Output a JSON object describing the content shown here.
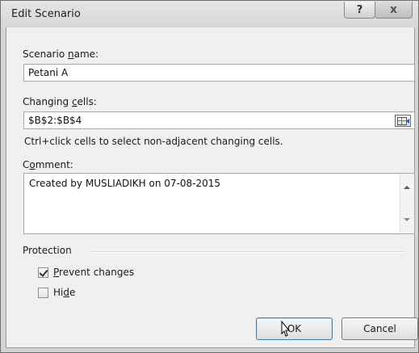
{
  "window": {
    "title": "Edit Scenario",
    "help_glyph": "?",
    "close_glyph": "x"
  },
  "scenario_name": {
    "label_pre": "Scenario ",
    "label_hot": "n",
    "label_post": "ame:",
    "value": "Petani A"
  },
  "changing_cells": {
    "label_pre": "Changing ",
    "label_hot": "c",
    "label_post": "ells:",
    "value": "$B$2:$B$4",
    "hint": "Ctrl+click cells to select non-adjacent changing cells."
  },
  "comment": {
    "label_pre": "C",
    "label_hot": "o",
    "label_post": "mment:",
    "value": "Created by MUSLIADIKH on 07-08-2015"
  },
  "protection": {
    "group_label": "Protection",
    "prevent_changes": {
      "hot": "P",
      "rest": "revent changes",
      "checked": true
    },
    "hide": {
      "pre": "Hi",
      "hot": "d",
      "post": "e",
      "checked": false
    }
  },
  "buttons": {
    "ok": "OK",
    "cancel": "Cancel"
  }
}
